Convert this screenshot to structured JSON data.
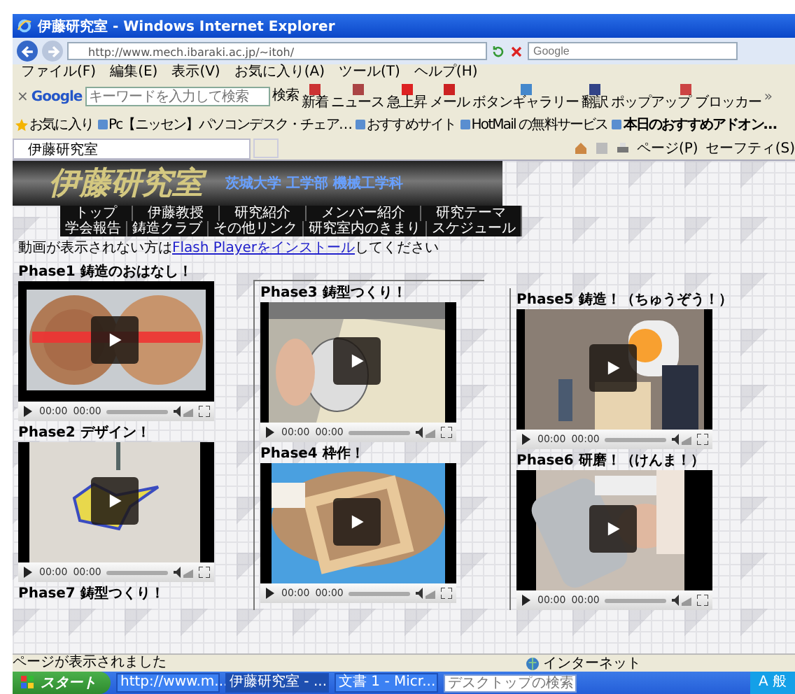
{
  "window": {
    "title": "伊藤研究室 - Windows Internet Explorer"
  },
  "address": {
    "url": "http://www.mech.ibaraki.ac.jp/~itoh/",
    "search_placeholder": "Google"
  },
  "menu": [
    "ファイル(F)",
    "編集(E)",
    "表示(V)",
    "お気に入り(A)",
    "ツール(T)",
    "ヘルプ(H)"
  ],
  "google_toolbar": {
    "close": "×",
    "logo": "Google",
    "placeholder": "キーワードを入力して検索",
    "search": "検索",
    "buttons": [
      "新着",
      "ニュース",
      "急上昇",
      "メール",
      "ボタンギャラリー",
      "翻訳",
      "ポップアップ ブロッカー"
    ],
    "more": "»"
  },
  "favorites": {
    "label": "お気に入り",
    "links": [
      "Pc【ニッセン】パソコンデスク・チェア…",
      "おすすめサイト",
      "HotMail の無料サービス",
      "本日のおすすめアドオン…"
    ]
  },
  "tabs": [
    {
      "label": "伊藤研究室",
      "selected": true
    }
  ],
  "command_bar": [
    "ページ(P)",
    "セーフティ(S)"
  ],
  "page": {
    "site_title": "伊藤研究室",
    "subtitle": "茨城大学 工学部 機械工学科",
    "nav": [
      [
        "トップ",
        "伊藤教授",
        "研究紹介",
        "メンバー紹介",
        "研究テーマ"
      ],
      [
        "学会報告",
        "鋳造クラブ",
        "その他リンク",
        "研究室内のきまり",
        "スケジュール"
      ]
    ],
    "notice": {
      "before": "動画が表示されない方は",
      "link": "Flash Playerをインストール",
      "after": "してください"
    },
    "columns": [
      [
        {
          "title": "Phase1 鋳造のおはなし！",
          "time": "00:00",
          "duration": "00:00"
        },
        {
          "title": "Phase2 デザイン！",
          "time": "00:00",
          "duration": "00:00"
        },
        {
          "title": "Phase7 鋳型つくり！"
        }
      ],
      [
        {
          "title": "Phase3 鋳型つくり！",
          "time": "00:00",
          "duration": "00:00"
        },
        {
          "title": "Phase4 枠作！",
          "time": "00:00",
          "duration": "00:00"
        }
      ],
      [
        {
          "title": "Phase5 鋳造！（ちゅうぞう！）",
          "time": "00:00",
          "duration": "00:00"
        },
        {
          "title": "Phase6 研磨！（けんま！）",
          "time": "00:00",
          "duration": "00:00"
        }
      ]
    ]
  },
  "status_bar": {
    "text": "ページが表示されました",
    "zone": "インターネット"
  },
  "taskbar": {
    "start": "スタート",
    "tasks": [
      {
        "label": "http://www.m...",
        "selected": false
      },
      {
        "label": "伊藤研究室 - ...",
        "selected": true
      },
      {
        "label": "文書 1 - Micr...",
        "selected": false
      }
    ],
    "search_placeholder": "デスクトップの検索",
    "tray": "A 般"
  }
}
